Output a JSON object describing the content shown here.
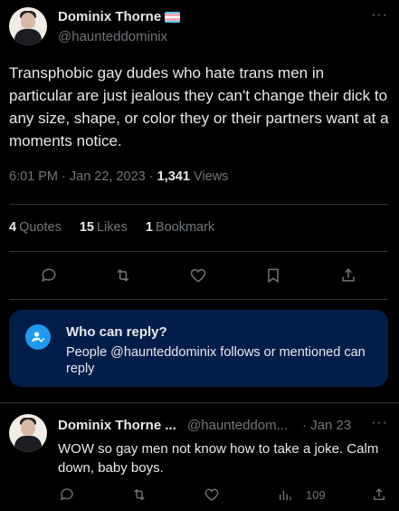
{
  "tweet": {
    "author_name": "Dominix Thorne",
    "author_handle": "@haunteddominix",
    "text": "Transphobic gay dudes who hate trans men in particular are just jealous they can't change their dick to any size, shape, or color they or their partners want at a moments notice.",
    "time": "6:01 PM · Jan 22, 2023 ·",
    "views_count": "1,341",
    "views_label": "Views",
    "more_label": "···"
  },
  "stats": {
    "quotes_count": "4",
    "quotes_label": "Quotes",
    "likes_count": "15",
    "likes_label": "Likes",
    "bookmarks_count": "1",
    "bookmarks_label": "Bookmark"
  },
  "who_can_reply": {
    "title": "Who can reply?",
    "description": "People @haunteddominix follows or mentioned can reply"
  },
  "reply": {
    "author_name": "Dominix Thorne ...",
    "author_handle": "@haunteddom...",
    "time": "· Jan 23",
    "text": "WOW so gay men not know how to take a joke. Calm down, baby boys.",
    "views_count": "109",
    "more_label": "···"
  },
  "colors": {
    "background": "#000000",
    "text": "#e7e9ea",
    "muted": "#71767b",
    "accent": "#1d9bf0",
    "reply_box": "#031d4a",
    "trans_flag": [
      "#5bcefa",
      "#f5a9b8",
      "#ffffff",
      "#f5a9b8",
      "#5bcefa"
    ]
  }
}
